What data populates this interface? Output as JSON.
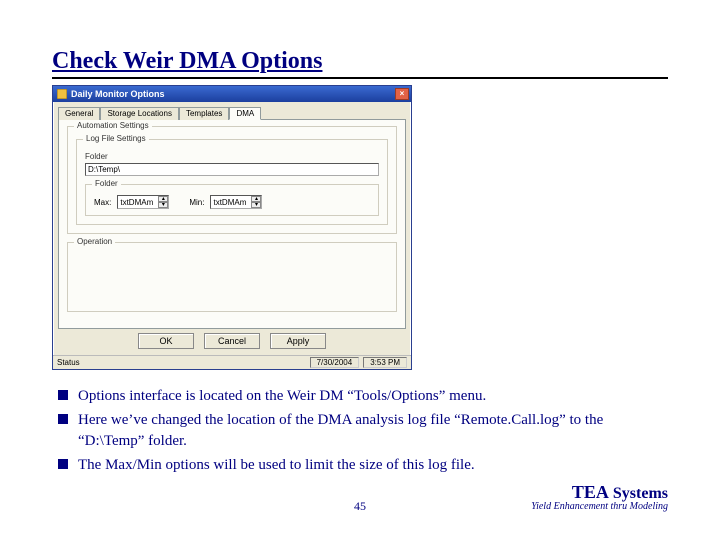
{
  "title": "Check Weir DMA Options",
  "dialog": {
    "title": "Daily Monitor Options",
    "close_label": "×",
    "tabs": [
      {
        "label": "General"
      },
      {
        "label": "Storage Locations"
      },
      {
        "label": "Templates"
      },
      {
        "label": "DMA"
      }
    ],
    "automation_legend": "Automation Settings",
    "logfile": {
      "legend": "Log File Settings",
      "folder_label": "Folder",
      "folder_value": "D:\\Temp\\",
      "sub_legend": "Folder",
      "max_label": "Max:",
      "max_value": "txtDMAm",
      "min_label": "Min:",
      "min_value": "txtDMAm"
    },
    "operation_legend": "Operation",
    "buttons": {
      "ok": "OK",
      "cancel": "Cancel",
      "apply": "Apply"
    },
    "status": {
      "left": "Status",
      "date": "7/30/2004",
      "time": "3:53 PM"
    }
  },
  "bullets": [
    "Options interface is located on the Weir DM “Tools/Options” menu.",
    "Here we’ve changed the location of the DMA analysis log file “Remote.Call.log” to the “D:\\Temp” folder.",
    "The Max/Min options will be used to limit the size of this log file."
  ],
  "page_number": "45",
  "footer": {
    "brand_tea": "TEA",
    "brand_sys": " Systems",
    "tagline": "Yield Enhancement thru Modeling"
  }
}
